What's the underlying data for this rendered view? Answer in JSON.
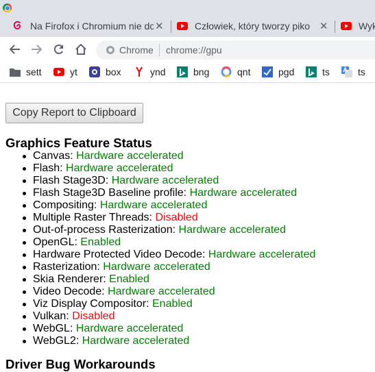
{
  "browser": {
    "tabs": [
      {
        "title": "Na Firofox i Chromium nie do"
      },
      {
        "title": "Człowiek, który tworzy piko"
      },
      {
        "title": "Wyk"
      }
    ],
    "close_glyph": "✕",
    "omnibox_chip": "Chrome",
    "url": "chrome://gpu"
  },
  "bookmarks": [
    {
      "label": "sett",
      "icon": "folder-icon"
    },
    {
      "label": "yt",
      "icon": "youtube-icon"
    },
    {
      "label": "box",
      "icon": "box-icon"
    },
    {
      "label": "ynd",
      "icon": "yandex-icon"
    },
    {
      "label": "bng",
      "icon": "bing-icon"
    },
    {
      "label": "qnt",
      "icon": "qwant-icon"
    },
    {
      "label": "pgd",
      "icon": "pgd-icon"
    },
    {
      "label": "ts",
      "icon": "bing-icon"
    },
    {
      "label": "ts",
      "icon": "translate-icon"
    }
  ],
  "page": {
    "copy_button": "Copy Report to Clipboard",
    "section_title": "Graphics Feature Status",
    "features": [
      {
        "name": "Canvas:",
        "status": "Hardware accelerated",
        "color": "#008000"
      },
      {
        "name": "Flash:",
        "status": "Hardware accelerated",
        "color": "#008000"
      },
      {
        "name": "Flash Stage3D:",
        "status": "Hardware accelerated",
        "color": "#008000"
      },
      {
        "name": "Flash Stage3D Baseline profile:",
        "status": "Hardware accelerated",
        "color": "#008000"
      },
      {
        "name": "Compositing:",
        "status": "Hardware accelerated",
        "color": "#008000"
      },
      {
        "name": "Multiple Raster Threads:",
        "status": "Disabled",
        "color": "#ff0000"
      },
      {
        "name": "Out-of-process Rasterization:",
        "status": "Hardware accelerated",
        "color": "#008000"
      },
      {
        "name": "OpenGL:",
        "status": "Enabled",
        "color": "#008000"
      },
      {
        "name": "Hardware Protected Video Decode:",
        "status": "Hardware accelerated",
        "color": "#008000"
      },
      {
        "name": "Rasterization:",
        "status": "Hardware accelerated",
        "color": "#008000"
      },
      {
        "name": "Skia Renderer:",
        "status": "Enabled",
        "color": "#008000"
      },
      {
        "name": "Video Decode:",
        "status": "Hardware accelerated",
        "color": "#008000"
      },
      {
        "name": "Viz Display Compositor:",
        "status": "Enabled",
        "color": "#008000"
      },
      {
        "name": "Vulkan:",
        "status": "Disabled",
        "color": "#ff0000"
      },
      {
        "name": "WebGL:",
        "status": "Hardware accelerated",
        "color": "#008000"
      },
      {
        "name": "WebGL2:",
        "status": "Hardware accelerated",
        "color": "#008000"
      }
    ],
    "next_section_title": "Driver Bug Workarounds"
  }
}
